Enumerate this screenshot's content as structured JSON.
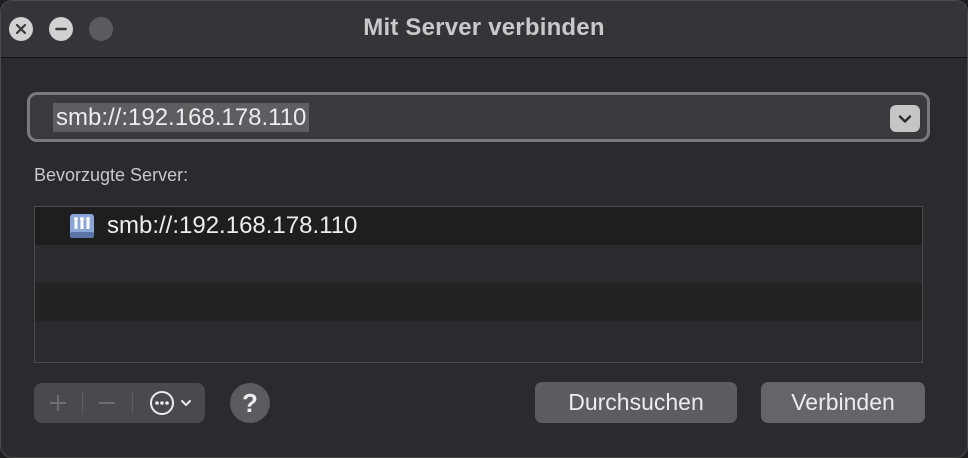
{
  "window": {
    "title": "Mit Server verbinden"
  },
  "address": {
    "value": "smb://:192.168.178.110"
  },
  "favorites": {
    "label": "Bevorzugte Server:",
    "items": [
      {
        "label": "smb://:192.168.178.110",
        "icon": "network-server-icon"
      }
    ]
  },
  "toolbar": {
    "add_icon": "plus-icon",
    "remove_icon": "minus-icon",
    "more_icon": "ellipsis-circle-icon",
    "help_label": "?",
    "browse_label": "Durchsuchen",
    "connect_label": "Verbinden"
  },
  "colors": {
    "window_bg": "#2b2a2c",
    "titlebar_bg": "#353436",
    "selection_bg": "#5e5e60"
  }
}
